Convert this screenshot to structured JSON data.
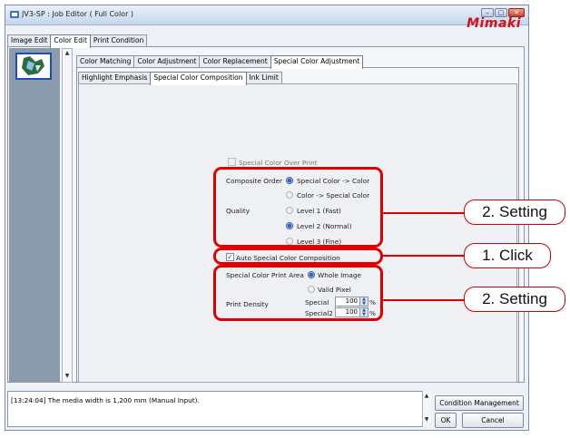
{
  "window": {
    "title": "JV3-SP : Job Editor ( Full Color )",
    "brand": "Mimaki",
    "controls": [
      "–",
      "□",
      "✕"
    ]
  },
  "tabs_top": [
    "Image Edit",
    "Color Edit",
    "Print Condition"
  ],
  "tabs_second": [
    "Color Matching",
    "Color Adjustment",
    "Color Replacement",
    "Special Color Adjustment"
  ],
  "tabs_third": [
    "Highlight Emphasis",
    "Special Color Composition",
    "Ink Limit"
  ],
  "form": {
    "over_print_label": "Special Color Over Print",
    "composite_order_label": "Composite Order",
    "composite_options": [
      "Special Color -> Color",
      "Color -> Special Color"
    ],
    "quality_label": "Quality",
    "quality_options": [
      "Level 1 (Fast)",
      "Level 2 (Normal)",
      "Level 3 (Fine)"
    ],
    "auto_label": "Auto Special Color Composition",
    "print_area_label": "Special Color Print Area",
    "print_area_options": [
      "Whole Image",
      "Valid Pixel"
    ],
    "print_density_label": "Print Density",
    "density_rows": [
      {
        "label": "Special",
        "value": "100",
        "unit": "%"
      },
      {
        "label": "Special2",
        "value": "100",
        "unit": "%"
      }
    ]
  },
  "state": {
    "over_print_checked": false,
    "over_print_enabled": false,
    "auto_checked": true,
    "composite_selected": 0,
    "quality_selected": 1,
    "print_area_selected": 0
  },
  "log": {
    "text": "[13:24:04] The media width is 1,200 mm (Manual Input)."
  },
  "buttons": {
    "condition_management": "Condition Management",
    "ok": "OK",
    "cancel": "Cancel"
  },
  "annotations": {
    "setting_top": "2. Setting",
    "click": "1. Click",
    "setting_bottom": "2. Setting"
  },
  "colors": {
    "accent": "#2a63c9",
    "callout": "#e00000",
    "brand": "#d6101a"
  },
  "icons": {
    "app": "app-icon",
    "up": "scroll-up-icon",
    "down": "scroll-down-icon"
  }
}
